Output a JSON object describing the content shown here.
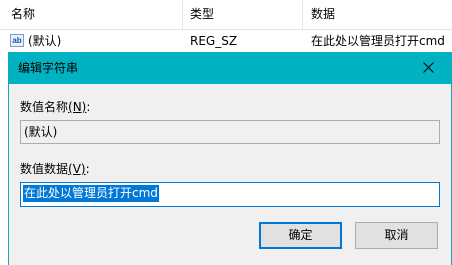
{
  "list": {
    "columns": [
      "名称",
      "类型",
      "数据"
    ],
    "rows": [
      {
        "icon": "registry-string-icon",
        "icon_text": "ab",
        "name": "(默认)",
        "type": "REG_SZ",
        "data": "在此处以管理员打开cmd"
      }
    ]
  },
  "dialog": {
    "title": "编辑字符串",
    "close_icon": "close-icon",
    "value_name_label": "数值名称",
    "value_name_accel": "(N)",
    "value_name_suffix": ":",
    "value_name": "(默认)",
    "value_data_label": "数值数据",
    "value_data_accel": "(V)",
    "value_data_suffix": ":",
    "value_data": "在此处以管理员打开cmd",
    "ok_label": "确定",
    "cancel_label": "取消"
  },
  "colors": {
    "title_bar": "#00b2c2",
    "selection": "#0078d7",
    "dialog_bg": "#f0f0f0"
  }
}
